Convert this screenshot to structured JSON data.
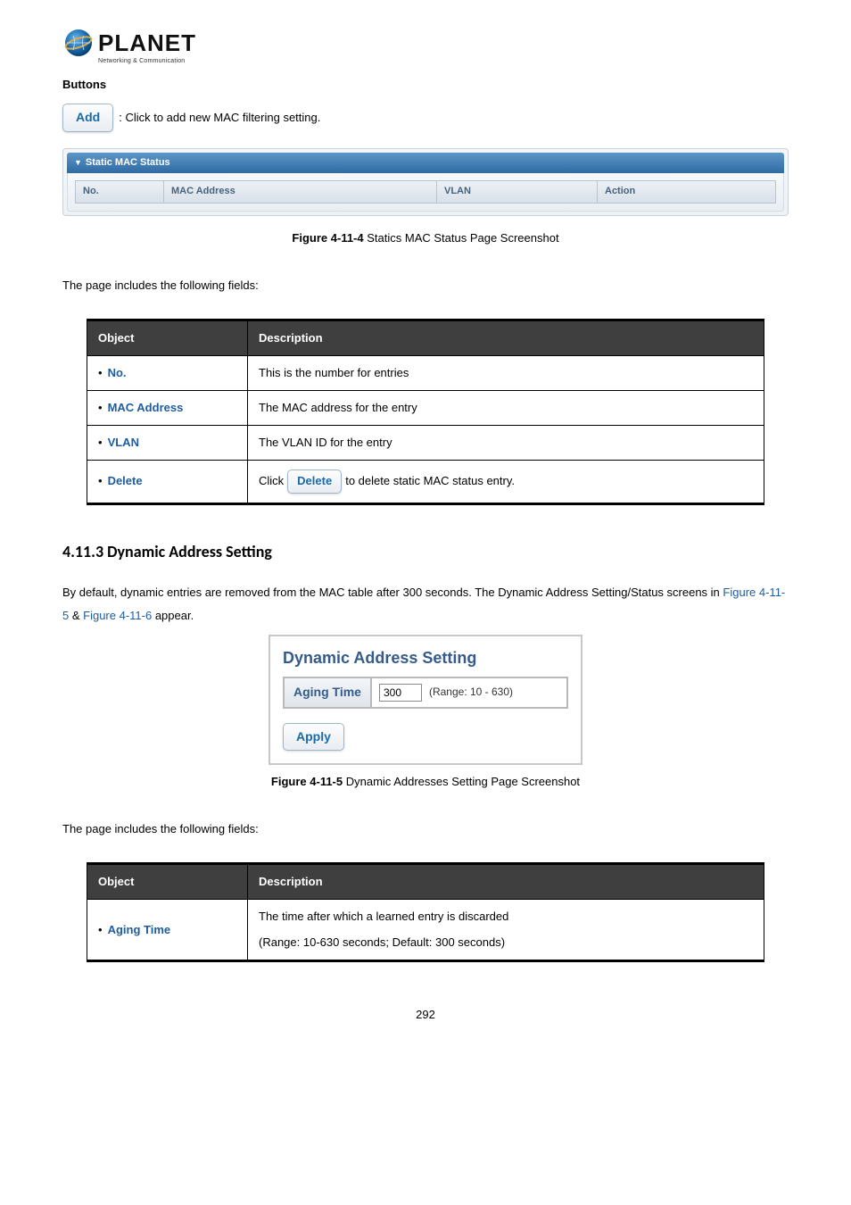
{
  "logo": {
    "brand": "PLANET",
    "tagline": "Networking & Communication"
  },
  "buttons_heading": "Buttons",
  "add_button": {
    "label": "Add",
    "desc": ": Click to add new MAC filtering setting."
  },
  "static_panel": {
    "title": "Static MAC Status",
    "cols": {
      "no": "No.",
      "mac": "MAC Address",
      "vlan": "VLAN",
      "action": "Action"
    }
  },
  "fig1": {
    "ref": "Figure 4-11-4",
    "caption": " Statics MAC Status Page Screenshot"
  },
  "intro1": "The page includes the following fields:",
  "table1": {
    "head": {
      "obj": "Object",
      "desc": "Description"
    },
    "rows": [
      {
        "key": "No.",
        "desc": "This is the number for entries"
      },
      {
        "key": "MAC Address",
        "desc": "The MAC address for the entry"
      },
      {
        "key": "VLAN",
        "desc": "The VLAN ID for the entry"
      },
      {
        "key": "Delete",
        "pre": "Click ",
        "btn": "Delete",
        "post": " to delete static MAC status entry."
      }
    ]
  },
  "section": "4.11.3 Dynamic Address Setting",
  "para2a": "By default, dynamic entries are removed from the MAC table after 300 seconds. The Dynamic Address Setting/Status screens in ",
  "para2_link1": "Figure 4-11-5",
  "para2_amp": " & ",
  "para2_link2": "Figure 4-11-6",
  "para2b": " appear.",
  "das": {
    "title": "Dynamic Address Setting",
    "label": "Aging Time",
    "value": "300",
    "range": "(Range: 10 - 630)",
    "apply": "Apply"
  },
  "fig2": {
    "ref": "Figure 4-11-5",
    "caption": " Dynamic Addresses Setting Page Screenshot"
  },
  "intro2": "The page includes the following fields:",
  "table2": {
    "head": {
      "obj": "Object",
      "desc": "Description"
    },
    "row": {
      "key": "Aging Time",
      "line1": "The time after which a learned entry is discarded",
      "line2": "(Range: 10-630 seconds; Default: 300 seconds)"
    }
  },
  "page_number": "292"
}
